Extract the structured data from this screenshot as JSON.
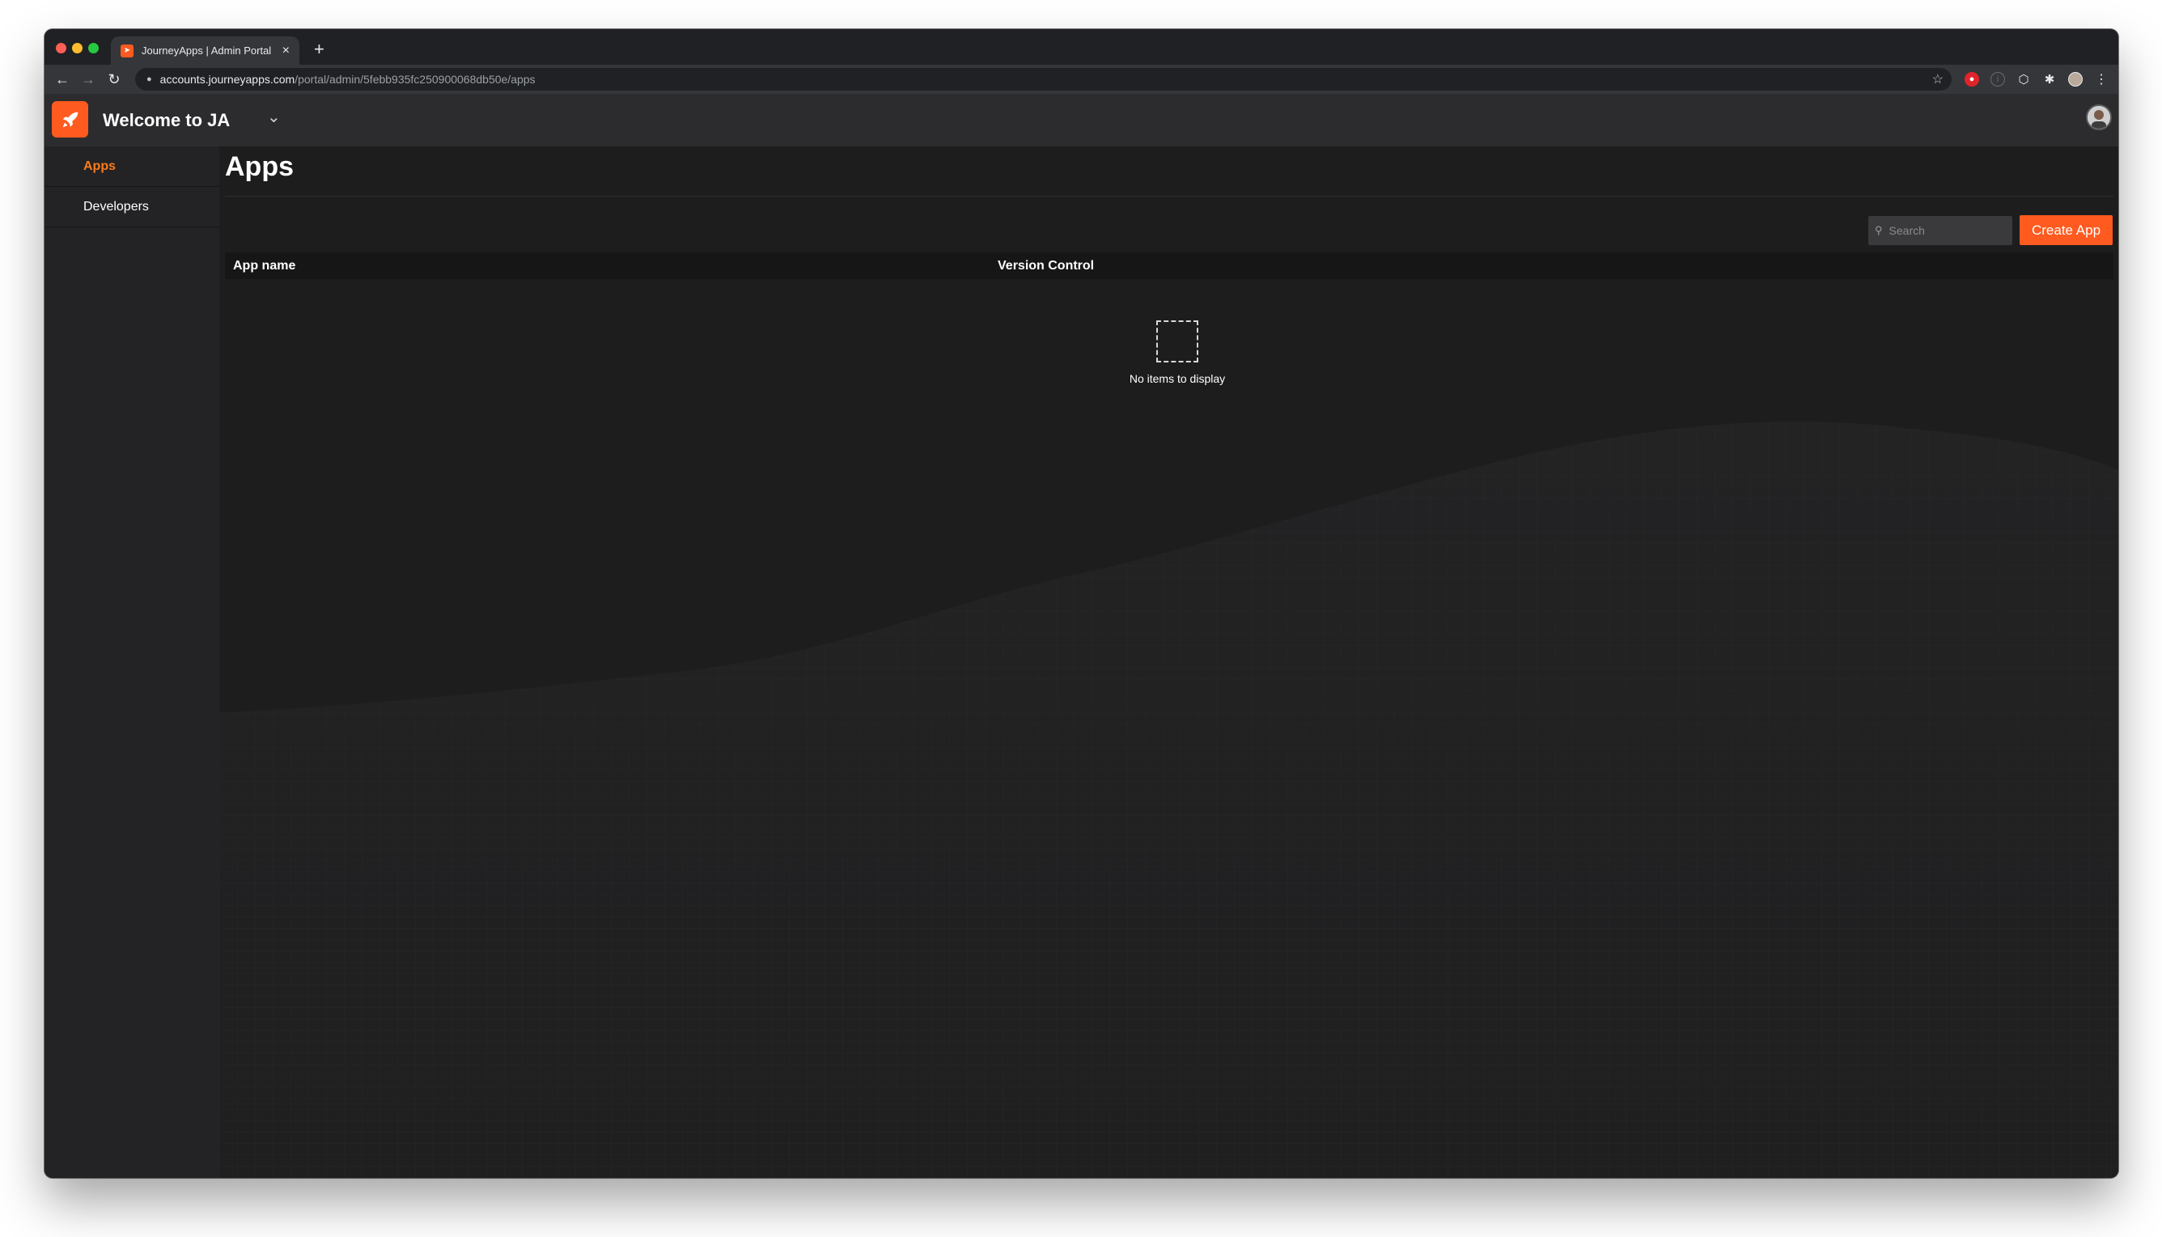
{
  "browser": {
    "tab_title": "JourneyApps | Admin Portal",
    "new_tab_label": "+",
    "url_host": "accounts.journeyapps.com",
    "url_path": "/portal/admin/5febb935fc250900068db50e/apps"
  },
  "header": {
    "org_name": "Welcome to JA"
  },
  "sidebar": {
    "items": [
      {
        "label": "Apps",
        "active": true
      },
      {
        "label": "Developers",
        "active": false
      }
    ]
  },
  "main": {
    "title": "Apps",
    "search_placeholder": "Search",
    "create_button": "Create App",
    "columns": [
      "App name",
      "Version Control"
    ],
    "empty_message": "No items to display"
  },
  "colors": {
    "accent": "#ff5a1f",
    "active_nav": "#ff7a1a",
    "background": "#1d1d1e"
  }
}
